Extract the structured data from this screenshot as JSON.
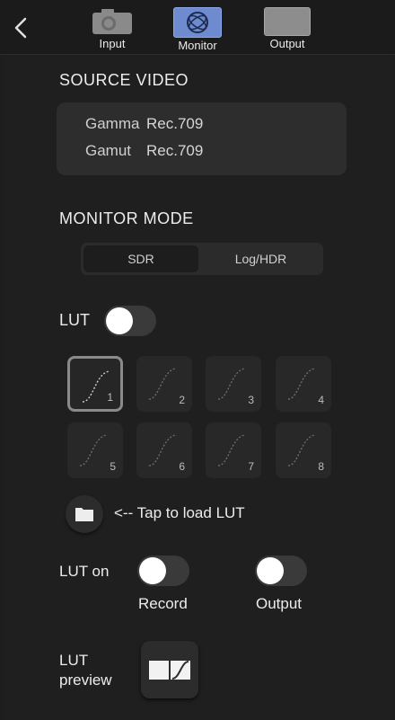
{
  "tabs": [
    {
      "label": "Input",
      "icon": "camera-icon"
    },
    {
      "label": "Monitor",
      "icon": "atomos-monitor-icon"
    },
    {
      "label": "Output",
      "icon": "display-output-icon"
    }
  ],
  "source_video": {
    "title": "SOURCE VIDEO",
    "gamma_key": "Gamma",
    "gamma_value": "Rec.709",
    "gamut_key": "Gamut",
    "gamut_value": "Rec.709"
  },
  "monitor_mode": {
    "title": "MONITOR MODE",
    "options": [
      "SDR",
      "Log/HDR"
    ],
    "selected": "SDR"
  },
  "lut": {
    "label": "LUT",
    "enabled": false,
    "slots": [
      "1",
      "2",
      "3",
      "4",
      "5",
      "6",
      "7",
      "8"
    ],
    "selected_slot": "1",
    "load_hint": "<-- Tap to load LUT"
  },
  "lut_on": {
    "label": "LUT on",
    "record_label": "Record",
    "record_enabled": false,
    "output_label": "Output",
    "output_enabled": false
  },
  "lut_preview": {
    "label_line1": "LUT",
    "label_line2": "preview"
  },
  "colors": {
    "background": "#1f1f1f",
    "panel": "#2d2d2d",
    "monitor_tab_accent": "#6f8bcf"
  }
}
